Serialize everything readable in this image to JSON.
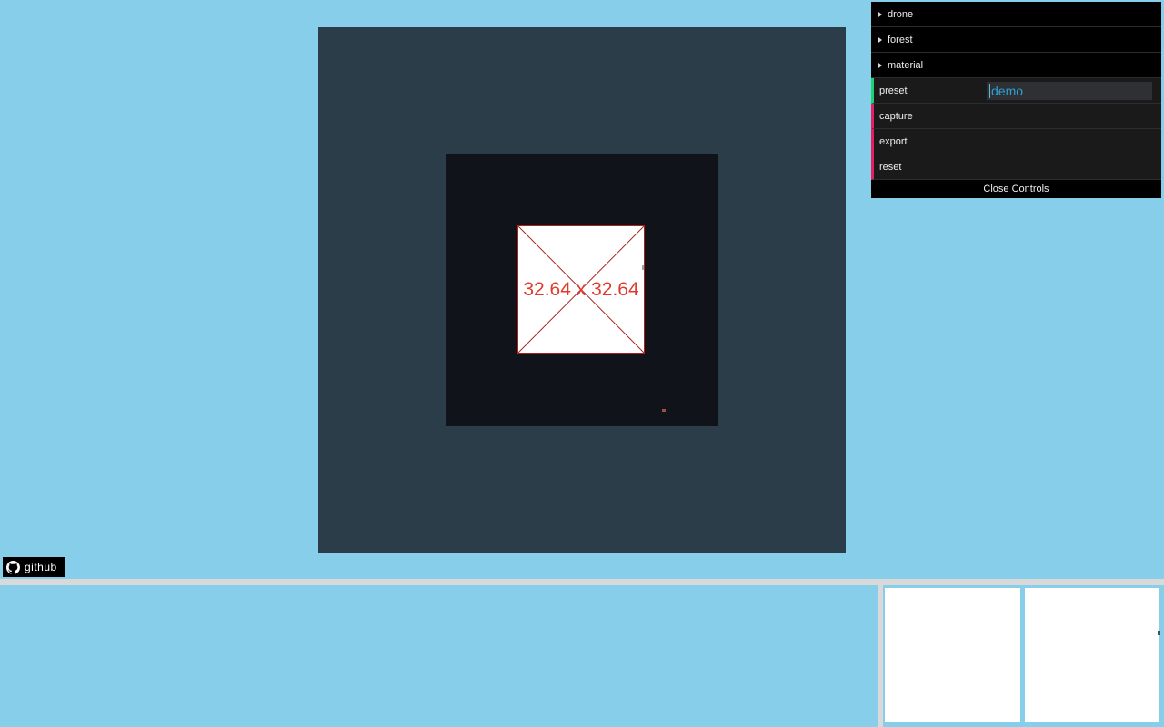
{
  "gui": {
    "folders": [
      {
        "label": "drone"
      },
      {
        "label": "forest"
      },
      {
        "label": "material"
      }
    ],
    "preset": {
      "label": "preset",
      "value": "demo"
    },
    "actions": [
      {
        "label": "capture"
      },
      {
        "label": "export"
      },
      {
        "label": "reset"
      }
    ],
    "close_label": "Close Controls",
    "colors": {
      "string_accent": "#1ed36f",
      "function_accent": "#e61d5f",
      "value_text": "#2FA1D6",
      "row_bg": "#1a1a1a",
      "folder_bg": "#000000"
    }
  },
  "viewport": {
    "texture_label": "32.64 x 32.64",
    "colors": {
      "scene_bg": "#2b3d49",
      "render_bg": "#10141a",
      "placeholder_red": "#a8221e",
      "label_red": "#e03a2c"
    }
  },
  "github": {
    "label": "github",
    "icon": "github-octocat-icon"
  },
  "page": {
    "background": "#87CEEB",
    "divider_gray": "#d9d9d9"
  }
}
